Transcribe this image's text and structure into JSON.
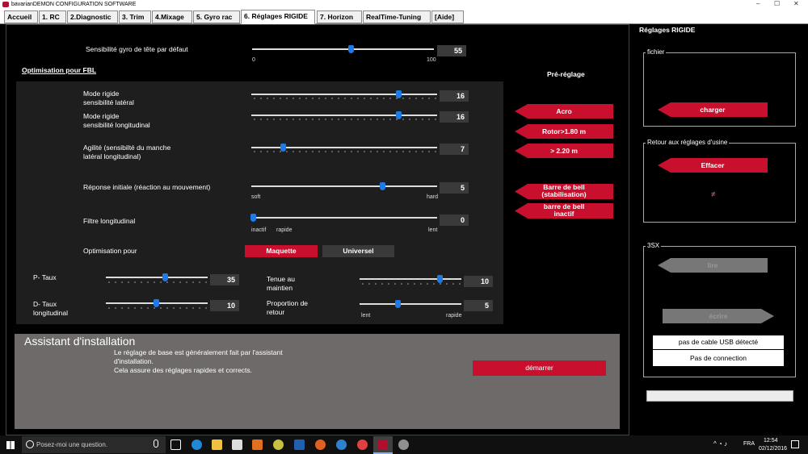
{
  "window": {
    "title": "bavarianDEMON CONFIGURATION SOFTWARE",
    "min": "–",
    "max": "☐",
    "close": "✕"
  },
  "tabs": [
    "Accueil",
    "1. RC",
    "2.Diagnostic",
    "3. Trim",
    "4.Mixage",
    "5. Gyro rac",
    "6. Réglages RIGIDE",
    "7. Horizon",
    "RealTime-Tuning",
    "[Aide]"
  ],
  "active_tab": "6. Réglages RIGIDE",
  "tail_gyro": {
    "label": "Sensibilité gyro de tête par défaut",
    "value": "55",
    "fraction": 0.55,
    "min_label": "0",
    "max_label": "100"
  },
  "fbl": {
    "title": "Optimisation pour FBL",
    "mode_lateral": {
      "label1": "Mode rigide",
      "label2": "sensibilité latéral",
      "value": "16",
      "fraction": 0.78
    },
    "mode_long": {
      "label1": "Mode rigide",
      "label2": "sensibilité longitudinal",
      "value": "16",
      "fraction": 0.78
    },
    "agility": {
      "label1": "Agilité (sensibilté du manche",
      "label2": "latéral  longitudinal)",
      "value": "7",
      "fraction": 0.17
    },
    "response": {
      "label": "Réponse initiale (réaction au mouvement)",
      "value": "5",
      "fraction": 0.7,
      "left": "soft",
      "right": "hard"
    },
    "filter": {
      "label": "Filtre longitudinal",
      "value": "0",
      "fraction": 0.0,
      "left": "inactif",
      "mid": "rapide",
      "right": "lent"
    },
    "optim": {
      "label": "Optimisation pour",
      "btn1": "Maquette",
      "btn2": "Universel"
    },
    "p_rate": {
      "label": "P- Taux",
      "value": "35",
      "fraction": 0.58
    },
    "d_rate": {
      "label1": "D- Taux",
      "label2": "longitudinal",
      "value": "10",
      "fraction": 0.49
    },
    "hold": {
      "label1": "Tenue au",
      "label2": "maintien",
      "value": "10",
      "fraction": 0.78
    },
    "return": {
      "label1": "Proportion de",
      "label2": "retour",
      "value": "5",
      "fraction": 0.37,
      "left": "lent",
      "right": "rapide"
    }
  },
  "preset": {
    "title": "Pré-réglage",
    "acro": "Acro",
    "rotor": "Rotor>1.80 m",
    "big": "> 2.20 m",
    "bell1a": "Barre de bell",
    "bell1b": "(stabilisation)",
    "bell2a": "barre de bell",
    "bell2b": "inactif"
  },
  "assistant": {
    "title": "Assistant d'installation",
    "line1": "Le réglage de base est généralement fait par l'assistant",
    "line2": "d'installation.",
    "line3": "Cela assure des réglages rapides et corrects.",
    "start": "démarrer"
  },
  "right": {
    "title": "Réglages RIGIDE",
    "file_group": "fichier",
    "load": "charger",
    "factory_group": "Retour aux réglages d'usine",
    "erase": "Effacer",
    "neq": "≠",
    "sx_group": "3SX",
    "read": "lire",
    "write": "écrire",
    "usb": "pas de cable USB détecté",
    "conn": "Pas de connection"
  },
  "taskbar": {
    "search": "Posez-moi une question.",
    "lang": "FRA",
    "time": "12:54",
    "date": "02/12/2016"
  }
}
